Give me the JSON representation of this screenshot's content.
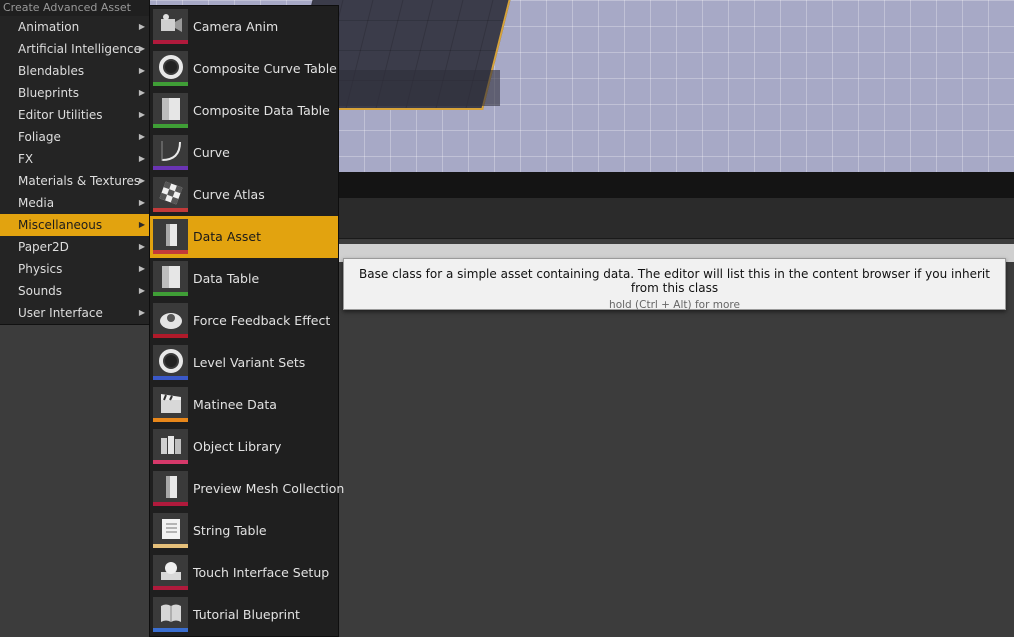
{
  "menu": {
    "header": "Create Advanced Asset",
    "categories": [
      {
        "label": "Animation"
      },
      {
        "label": "Artificial Intelligence"
      },
      {
        "label": "Blendables"
      },
      {
        "label": "Blueprints"
      },
      {
        "label": "Editor Utilities"
      },
      {
        "label": "Foliage"
      },
      {
        "label": "FX"
      },
      {
        "label": "Materials & Textures"
      },
      {
        "label": "Media"
      },
      {
        "label": "Miscellaneous",
        "active": true
      },
      {
        "label": "Paper2D"
      },
      {
        "label": "Physics"
      },
      {
        "label": "Sounds"
      },
      {
        "label": "User Interface"
      }
    ],
    "arrow_glyph": "▶"
  },
  "submenu": {
    "items": [
      {
        "label": "Camera Anim",
        "icon": "camera-anim-icon",
        "color": "#b01a3c"
      },
      {
        "label": "Composite Curve Table",
        "icon": "composite-curve-table-icon",
        "color": "#3f9e36"
      },
      {
        "label": "Composite Data Table",
        "icon": "composite-data-table-icon",
        "color": "#3f9e36"
      },
      {
        "label": "Curve",
        "icon": "curve-icon",
        "color": "#6a34b3"
      },
      {
        "label": "Curve Atlas",
        "icon": "curve-atlas-icon",
        "color": "#c23a3a"
      },
      {
        "label": "Data Asset",
        "icon": "data-asset-icon",
        "color": "#c23a3a",
        "active": true
      },
      {
        "label": "Data Table",
        "icon": "data-table-icon",
        "color": "#3f9e36"
      },
      {
        "label": "Force Feedback Effect",
        "icon": "force-feedback-icon",
        "color": "#b01a2a"
      },
      {
        "label": "Level Variant Sets",
        "icon": "level-variant-sets-icon",
        "color": "#3a58c8"
      },
      {
        "label": "Matinee Data",
        "icon": "matinee-data-icon",
        "color": "#e8871a"
      },
      {
        "label": "Object Library",
        "icon": "object-library-icon",
        "color": "#d6396a"
      },
      {
        "label": "Preview Mesh Collection",
        "icon": "preview-mesh-collection-icon",
        "color": "#b01a3c"
      },
      {
        "label": "String Table",
        "icon": "string-table-icon",
        "color": "#e6c07a"
      },
      {
        "label": "Touch Interface Setup",
        "icon": "touch-interface-setup-icon",
        "color": "#b01a3c"
      },
      {
        "label": "Tutorial Blueprint",
        "icon": "tutorial-blueprint-icon",
        "color": "#3a6ed0"
      }
    ]
  },
  "tooltip": {
    "text": "Base class for a simple asset containing data. The editor will list this in the content browser if you inherit from this class",
    "hint": "hold (Ctrl + Alt) for more"
  },
  "colors": {
    "accent": "#e2a30f",
    "menu_bg": "#242424",
    "viewport_floor": "#a7a9c6"
  }
}
